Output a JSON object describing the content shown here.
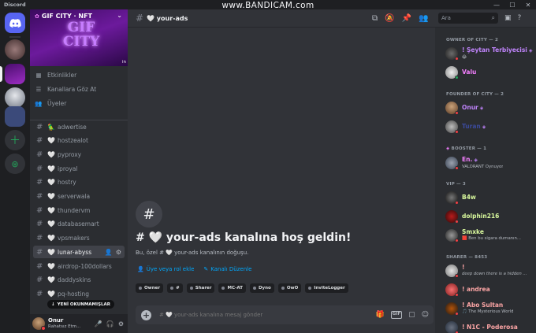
{
  "titlebar": {
    "app": "Discord",
    "watermark": "www.BANDICAM.com"
  },
  "server": {
    "name": "GIF CITY · NFT",
    "banner_art": "GIF CITY",
    "banner_in": "in"
  },
  "nav_items": [
    {
      "icon": "calendar-icon",
      "label": "Etkinlikler"
    },
    {
      "icon": "browse-channels-icon",
      "label": "Kanallara Göz At"
    },
    {
      "icon": "members-icon",
      "label": "Üyeler"
    }
  ],
  "channels": [
    {
      "emoji": "🦜",
      "name": "adwertise"
    },
    {
      "emoji": "🤍",
      "name": "hostzealot"
    },
    {
      "emoji": "🤍",
      "name": "pyproxy"
    },
    {
      "emoji": "🤍",
      "name": "iproyal"
    },
    {
      "emoji": "🤍",
      "name": "hostry"
    },
    {
      "emoji": "🤍",
      "name": "serverwala"
    },
    {
      "emoji": "🤍",
      "name": "thundervm"
    },
    {
      "emoji": "🤍",
      "name": "databasemart"
    },
    {
      "emoji": "🤍",
      "name": "vpsmakers"
    },
    {
      "emoji": "🤍",
      "name": "lunar-abyss",
      "active": true
    },
    {
      "emoji": "🤍",
      "name": "airdrop-100dollars"
    },
    {
      "emoji": "🤍",
      "name": "daddyskins"
    },
    {
      "emoji": "🤍",
      "name": "pq-hosting"
    }
  ],
  "unread_label": "YENİ OKUNMAMIŞLAR",
  "user": {
    "name": "Onur",
    "status": "Rahatsız Etm..."
  },
  "header": {
    "channel": "🤍 your-ads",
    "search_placeholder": "Ara"
  },
  "welcome": {
    "title": "# 🤍 your-ads kanalına hoş geldin!",
    "subtitle": "Bu, özel # 🤍 your-ads kanalının doğuşu.",
    "link_add": "Üye veya rol ekle",
    "link_edit": "Kanalı Düzenle"
  },
  "tags": [
    "Owner",
    "#",
    "Sharer",
    "MC-AT",
    "Dyno",
    "OwO",
    "InviteLogger"
  ],
  "composer": {
    "placeholder": "# 🤍 your-ads kanalına mesaj gönder"
  },
  "members": {
    "sections": [
      {
        "title": "OWNER OF CITY — 2",
        "members": [
          {
            "name": "! Şeytan Terbiyecisi",
            "color": "#c084fc",
            "status": "dnd",
            "activity": "😂"
          },
          {
            "name": "Valu",
            "color": "#f47fff",
            "status": "online",
            "activity": ""
          }
        ]
      },
      {
        "title": "FOUNDER OF CITY — 2",
        "members": [
          {
            "name": "Onur",
            "color": "#c084fc",
            "status": "dnd",
            "activity": ""
          },
          {
            "name": "Turan",
            "color": "#3b4a9c",
            "status": "dnd",
            "activity": ""
          }
        ]
      },
      {
        "title": "BOOSTER — 1",
        "members": [
          {
            "name": "En.",
            "color": "#f47fff",
            "status": "dnd",
            "activity": "VALORANT Oynuyor"
          }
        ]
      },
      {
        "title": "VIP — 3",
        "members": [
          {
            "name": "B4w",
            "color": "#d9f99d",
            "status": "dnd",
            "activity": ""
          },
          {
            "name": "dolphin216",
            "color": "#d9f99d",
            "status": "dnd",
            "activity": ""
          },
          {
            "name": "Smxke",
            "color": "#d9f99d",
            "status": "dnd",
            "activity": "🟥 Ben bu sigara dumanın..."
          }
        ]
      },
      {
        "title": "SHARER — 8453",
        "members": [
          {
            "name": "!",
            "color": "#fca5a5",
            "status": "dnd",
            "activity": "deep down there is a hidden ..."
          },
          {
            "name": "! andrea",
            "color": "#fca5a5",
            "status": "dnd",
            "activity": ""
          },
          {
            "name": "! Abo Sultan",
            "color": "#fca5a5",
            "status": "dnd",
            "activity": "🎵 The Mysterious World"
          },
          {
            "name": "! N1C - Poderosa",
            "color": "#fca5a5",
            "status": "dnd",
            "activity": ""
          }
        ]
      }
    ]
  }
}
